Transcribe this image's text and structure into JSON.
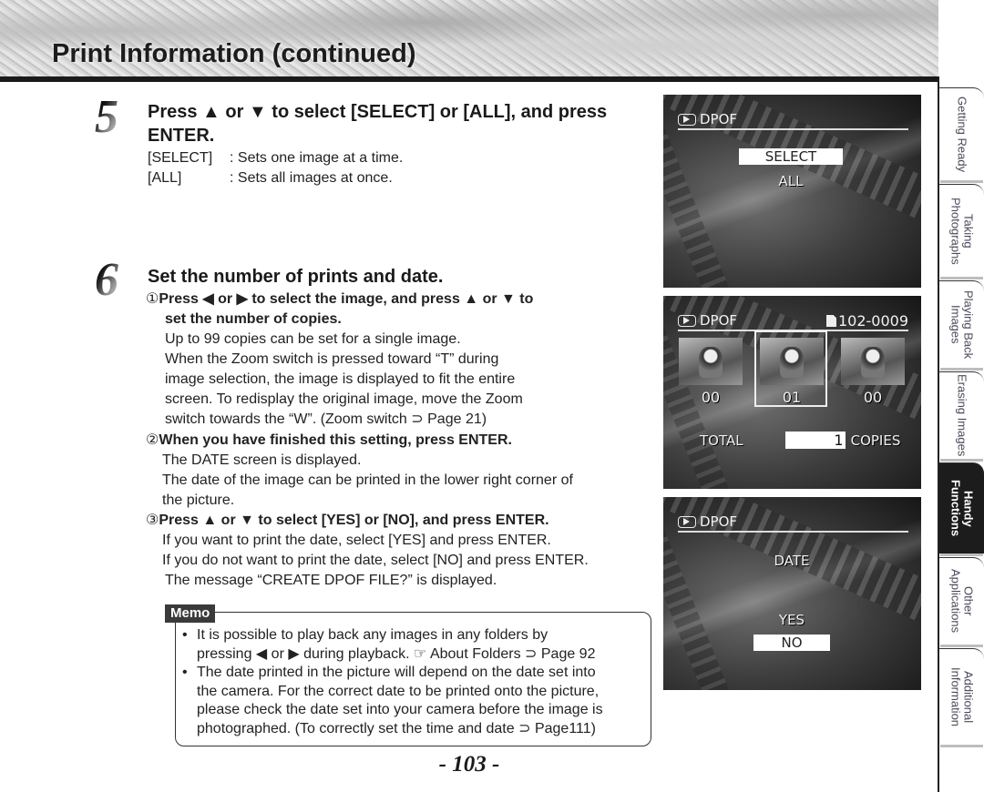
{
  "header": {
    "title": "Print Information (continued)"
  },
  "step5": {
    "number": "5",
    "title_line1": "Press ▲ or ▼ to select [SELECT] or [ALL], and press",
    "title_line2": "ENTER.",
    "definitions": [
      {
        "key": "[SELECT]",
        "value": ": Sets one image at a time."
      },
      {
        "key": "[ALL]",
        "value": ": Sets all images at once."
      }
    ]
  },
  "step6": {
    "number": "6",
    "title": "Set the number of prints and date.",
    "sub1": {
      "marker": "①",
      "title_line1": "Press ◀ or ▶ to select the image, and press ▲ or ▼ to",
      "title_line2": "set the number of copies.",
      "lines": [
        "Up to 99 copies can be set for a single image.",
        "When the Zoom switch is pressed toward “T” during",
        "image selection, the image is displayed to fit the entire",
        "screen. To redisplay the original image, move the Zoom",
        "switch towards the “W”. (Zoom switch ⊃ Page 21)"
      ]
    },
    "sub2": {
      "marker": "②",
      "title": "When you have finished this setting, press ENTER.",
      "lines": [
        "The DATE screen is displayed.",
        "The date of the image can be printed in the lower right corner of",
        "the picture."
      ]
    },
    "sub3": {
      "marker": "③",
      "title": "Press ▲ or ▼ to select [YES] or [NO], and press ENTER.",
      "lines": [
        "If you want to print the date, select [YES] and press ENTER.",
        "If you do not want to print the date, select [NO] and press ENTER.",
        "The message “CREATE DPOF FILE?” is displayed."
      ]
    }
  },
  "memo": {
    "label": "Memo",
    "items": [
      {
        "bullet": "•",
        "lines": [
          "It is possible to play back any images in any folders by",
          "pressing ◀ or ▶ during playback. ☞ About Folders ⊃ Page 92"
        ]
      },
      {
        "bullet": "•",
        "lines": [
          "The date printed in the picture will depend on the date set into",
          "the camera.  For the correct date to be printed onto the picture,",
          "please check the date set into your camera before the image is",
          "photographed. (To correctly set the time and date ⊃ Page111)"
        ]
      }
    ]
  },
  "screens": {
    "screen1": {
      "header": "DPOF",
      "options": [
        "SELECT",
        "ALL"
      ],
      "selected": "SELECT"
    },
    "screen2": {
      "header": "DPOF",
      "folder": "102-0009",
      "thumbnails": [
        {
          "count": "00"
        },
        {
          "count": "01",
          "selected": true
        },
        {
          "count": "00"
        }
      ],
      "total_label": "TOTAL",
      "total_value": "1",
      "copies_label": "COPIES"
    },
    "screen3": {
      "header": "DPOF",
      "title": "DATE",
      "options": [
        "YES",
        "NO"
      ],
      "selected": "NO"
    }
  },
  "side_tabs": [
    {
      "label": "Getting Ready",
      "active": false
    },
    {
      "label": "Taking Photographs",
      "active": false
    },
    {
      "label": "Playing Back Images",
      "active": false
    },
    {
      "label": "Erasing Images",
      "active": false
    },
    {
      "label": "Handy Functions",
      "active": true
    },
    {
      "label": "Other Applications",
      "active": false
    },
    {
      "label": "Additional Information",
      "active": false
    }
  ],
  "page_number": "- 103 -",
  "colors": {
    "text": "#1a1a1a",
    "active_tab": "#1c1c1c",
    "tab_text": "#4a4a5a"
  }
}
